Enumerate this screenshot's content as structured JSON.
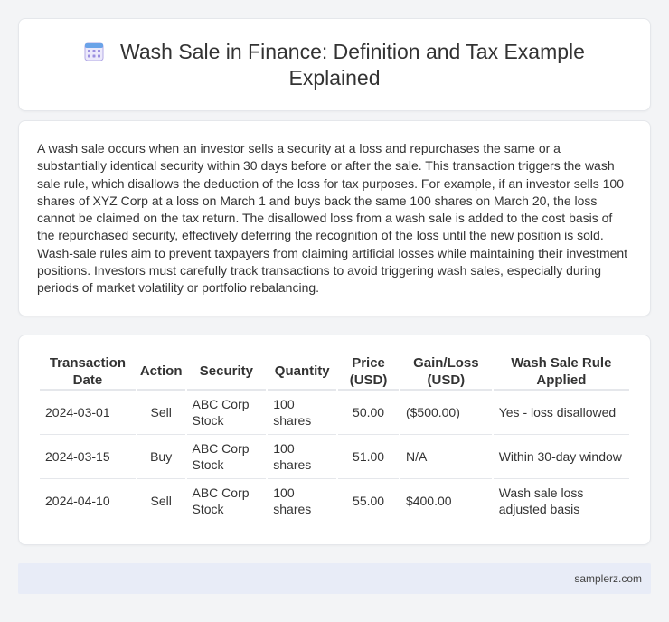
{
  "header": {
    "icon": "calendar-icon",
    "title": "Wash Sale in Finance: Definition and Tax Example Explained"
  },
  "article": {
    "paragraph": "A wash sale occurs when an investor sells a security at a loss and repurchases the same or a substantially identical security within 30 days before or after the sale. This transaction triggers the wash sale rule, which disallows the deduction of the loss for tax purposes. For example, if an investor sells 100 shares of XYZ Corp at a loss on March 1 and buys back the same 100 shares on March 20, the loss cannot be claimed on the tax return. The disallowed loss from a wash sale is added to the cost basis of the repurchased security, effectively deferring the recognition of the loss until the new position is sold. Wash-sale rules aim to prevent taxpayers from claiming artificial losses while maintaining their investment positions. Investors must carefully track transactions to avoid triggering wash sales, especially during periods of market volatility or portfolio rebalancing."
  },
  "table": {
    "headers": [
      "Transaction Date",
      "Action",
      "Security",
      "Quantity",
      "Price (USD)",
      "Gain/Loss (USD)",
      "Wash Sale Rule Applied"
    ],
    "rows": [
      [
        "2024-03-01",
        "Sell",
        "ABC Corp Stock",
        "100 shares",
        "50.00",
        "($500.00)",
        "Yes - loss disallowed"
      ],
      [
        "2024-03-15",
        "Buy",
        "ABC Corp Stock",
        "100 shares",
        "51.00",
        "N/A",
        "Within 30-day window"
      ],
      [
        "2024-04-10",
        "Sell",
        "ABC Corp Stock",
        "100 shares",
        "55.00",
        "$400.00",
        "Wash sale loss adjusted basis"
      ]
    ]
  },
  "footer": {
    "site": "samplerz.com"
  },
  "colors": {
    "background": "#f3f4f6",
    "card": "#ffffff",
    "footer_bg": "#e8ecf7",
    "icon_accent": "#8b7fd4"
  }
}
